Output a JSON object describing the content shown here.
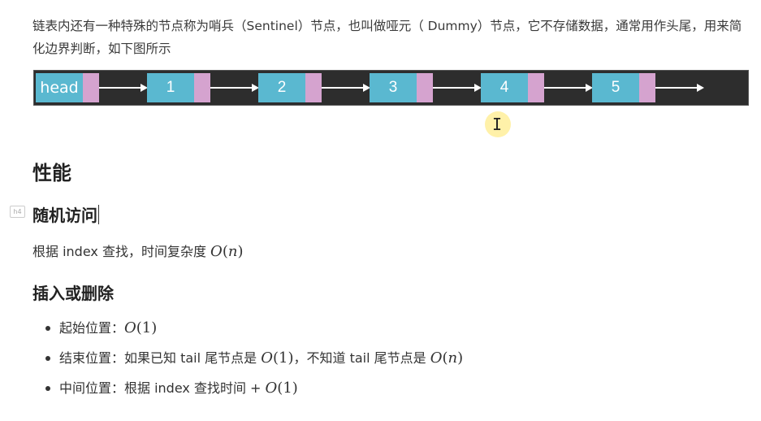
{
  "intro": {
    "text": "链表内还有一种特殊的节点称为哨兵（Sentinel）节点，也叫做哑元（ Dummy）节点，它不存储数据，通常用作头尾，用来简化边界判断，如下图所示"
  },
  "diagram": {
    "nodes": [
      "head",
      "1",
      "2",
      "3",
      "4",
      "5"
    ],
    "colors": {
      "background": "#2d2d2d",
      "value_cell": "#5ab8d0",
      "pointer_cell": "#d5a3cf",
      "arrow": "#ffffff"
    }
  },
  "sections": {
    "performance_title": "性能",
    "heading_badge": "h4",
    "random_access": {
      "title": "随机访问",
      "text_prefix": "根据 index 查找，时间复杂度 ",
      "complexity": "O(n)"
    },
    "insert_delete": {
      "title": "插入或删除",
      "items": [
        {
          "label": "起始位置：",
          "math": "O(1)"
        },
        {
          "label": "结束位置：如果已知 tail 尾节点是 ",
          "math": "O(1)",
          "suffix": "，不知道 tail 尾节点是 ",
          "math2": "O(n)"
        },
        {
          "label": "中间位置：根据 index 查找时间 + ",
          "math": "O(1)"
        }
      ]
    }
  },
  "cursor": {
    "icon": "text-ibeam-icon",
    "highlight_color": "#ffec8c"
  }
}
